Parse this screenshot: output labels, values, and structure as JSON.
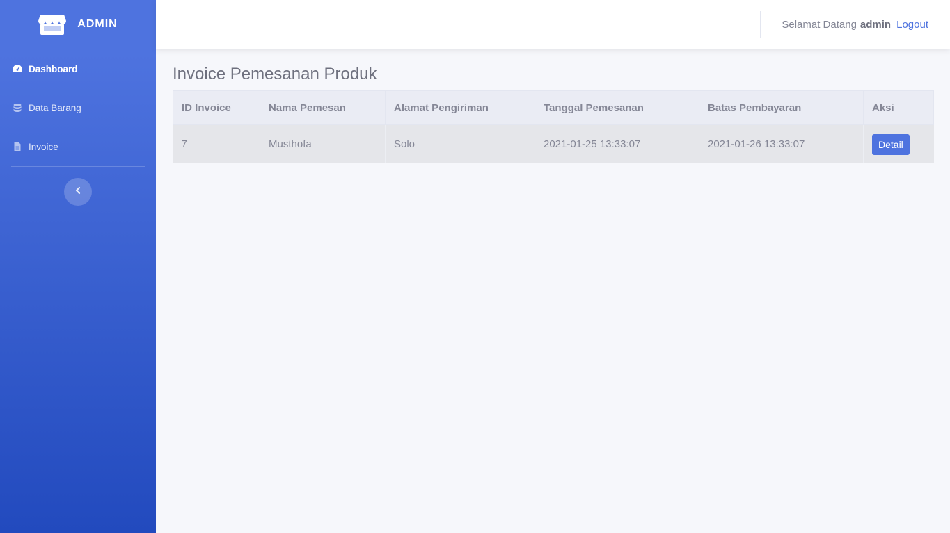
{
  "sidebar": {
    "brand": "ADMIN",
    "items": [
      {
        "label": "Dashboard",
        "icon": "tachometer-icon"
      },
      {
        "label": "Data Barang",
        "icon": "database-icon"
      },
      {
        "label": "Invoice",
        "icon": "file-icon"
      }
    ],
    "toggle_icon": "chevron-left-icon"
  },
  "topbar": {
    "welcome": "Selamat Datang",
    "user": "admin",
    "logout": "Logout"
  },
  "page": {
    "title": "Invoice Pemesanan Produk"
  },
  "table": {
    "headers": [
      "ID Invoice",
      "Nama Pemesan",
      "Alamat Pengiriman",
      "Tanggal Pemesanan",
      "Batas Pembayaran",
      "Aksi"
    ],
    "rows": [
      {
        "id": "7",
        "nama": "Musthofa",
        "alamat": "Solo",
        "tanggal": "2021-01-25 13:33:07",
        "batas": "2021-01-26 13:33:07",
        "aksi": "Detail"
      }
    ]
  },
  "colors": {
    "primary": "#4e73df",
    "sidebar_gradient_end": "#224abe"
  }
}
